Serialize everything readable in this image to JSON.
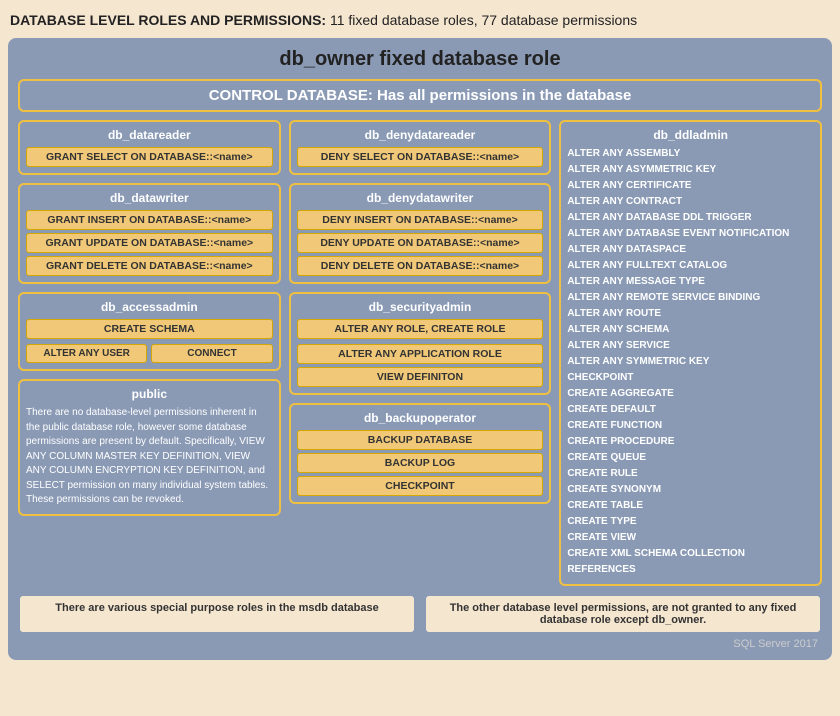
{
  "header": {
    "title_bold": "DATABASE LEVEL ROLES AND PERMISSIONS:",
    "title_normal": " 11 fixed database roles, 77 database permissions"
  },
  "outer": {
    "role_title": "db_owner  fixed  database  role",
    "control_banner": "CONTROL DATABASE: Has all permissions in the database"
  },
  "db_datareader": {
    "title": "db_datareader",
    "perms": [
      "GRANT SELECT ON DATABASE::<name>"
    ]
  },
  "db_denydatareader": {
    "title": "db_denydatareader",
    "perms": [
      "DENY SELECT ON DATABASE::<name>"
    ]
  },
  "db_datawriter": {
    "title": "db_datawriter",
    "perms": [
      "GRANT INSERT  ON DATABASE::<name>",
      "GRANT UPDATE  ON DATABASE::<name>",
      "GRANT DELETE  ON DATABASE::<name>"
    ]
  },
  "db_denydatawriter": {
    "title": "db_denydatawriter",
    "perms": [
      "DENY INSERT  ON DATABASE::<name>",
      "DENY UPDATE  ON DATABASE::<name>",
      "DENY DELETE  ON DATABASE::<name>"
    ]
  },
  "db_accessadmin": {
    "title": "db_accessadmin",
    "schema": "CREATE SCHEMA",
    "perms": [
      "ALTER ANY USER",
      "CONNECT"
    ]
  },
  "db_securityadmin": {
    "title": "db_securityadmin",
    "perms": [
      "ALTER ANY ROLE, CREATE ROLE",
      "ALTER ANY APPLICATION ROLE",
      "VIEW DEFINITON"
    ]
  },
  "db_backupoperator": {
    "title": "db_backupoperator",
    "perms": [
      "BACKUP DATABASE",
      "BACKUP LOG",
      "CHECKPOINT"
    ]
  },
  "public": {
    "title": "public",
    "text": "There are no database-level permissions inherent in the public database role, however some database permissions are present by default. Specifically, VIEW ANY COLUMN MASTER KEY DEFINITION, VIEW ANY COLUMN ENCRYPTION KEY DEFINITION, and SELECT permission on many individual system tables. These permissions can be revoked."
  },
  "db_ddladmin": {
    "title": "db_ddladmin",
    "perms": [
      "ALTER ANY ASSEMBLY",
      "ALTER ANY ASYMMETRIC  KEY",
      "ALTER ANY CERTIFICATE",
      "ALTER ANY CONTRACT",
      "ALTER ANY DATABASE DDL TRIGGER",
      "ALTER ANY DATABASE EVENT NOTIFICATION",
      "ALTER ANY DATASPACE",
      "ALTER ANY FULLTEXT CATALOG",
      "ALTER ANY MESSAGE TYPE",
      "ALTER ANY REMOTE SERVICE BINDING",
      "ALTER ANY ROUTE",
      "ALTER ANY SCHEMA",
      "ALTER ANY SERVICE",
      "ALTER ANY SYMMETRIC  KEY",
      "CHECKPOINT",
      "CREATE AGGREGATE",
      "CREATE DEFAULT",
      "CREATE FUNCTION",
      "CREATE PROCEDURE",
      "CREATE QUEUE",
      "CREATE RULE",
      "CREATE SYNONYM",
      "CREATE TABLE",
      "CREATE TYPE",
      "CREATE VIEW",
      "CREATE XML SCHEMA COLLECTION",
      "REFERENCES"
    ]
  },
  "bottom_notes": {
    "left": "There are various special purpose roles\nin the msdb database",
    "right": "The other database level permissions, are not granted\nto any fixed database role except db_owner."
  },
  "sql_version": "SQL Server 2017"
}
